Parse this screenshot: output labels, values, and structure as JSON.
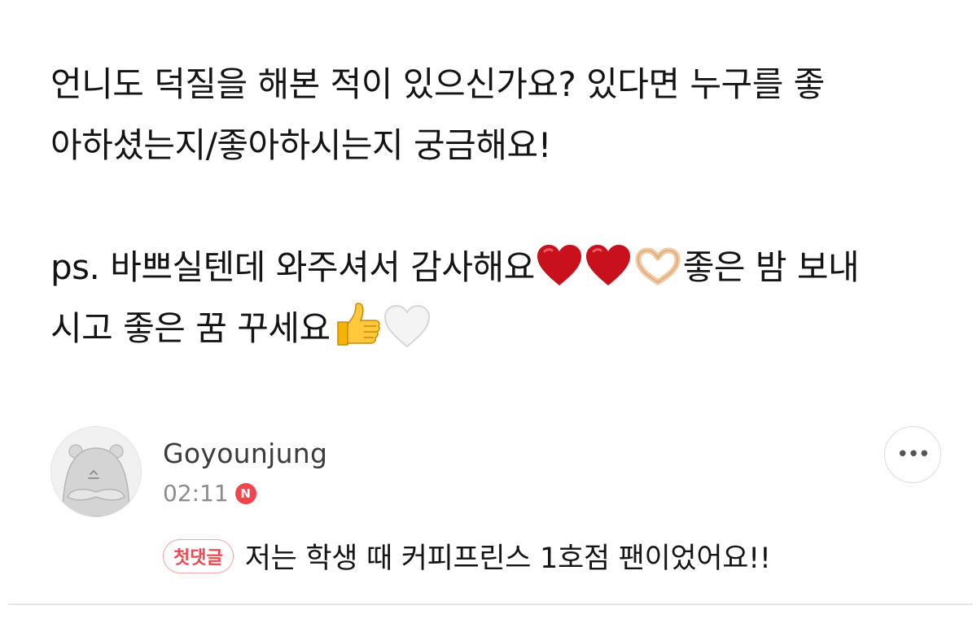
{
  "post": {
    "line1": "언니도 덕질을 해본 적이 있으신가요? 있다면 누구를 좋",
    "line2": "아하셨는지/좋아하시는지 궁금해요!",
    "ps_text": "ps. 바쁘실텐데 와주셔서 감사해요",
    "ps_text_after": "좋은 밤 보내",
    "line4": "시고 좋은 꿈 꾸세요",
    "emojis": [
      "red-heart",
      "red-heart",
      "heart-hands",
      "thumbs-up",
      "white-heart"
    ]
  },
  "comment": {
    "author": "Goyounjung",
    "time": "02:11",
    "new_badge": "N",
    "first_badge": "첫댓글",
    "text": "저는 학생 때 커피프린스 1호점 팬이었어요!!",
    "more_label": "•••"
  },
  "colors": {
    "new_badge": "#f0454c",
    "first_badge_text": "#ec4a52",
    "first_badge_border": "#f5a3a6",
    "author": "#3b3b3b",
    "time": "#8c8c8c"
  }
}
